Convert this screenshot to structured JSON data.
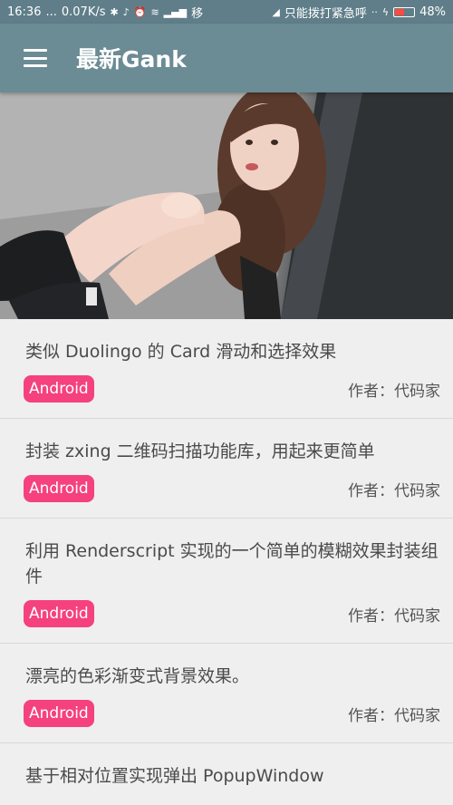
{
  "status_bar": {
    "time": "16:36",
    "dots": "...",
    "speed": "0.07K/s",
    "carrier": "移",
    "notification": "只能拨打紧急呼",
    "battery_percent": "48%",
    "battery_level": 0.48
  },
  "app_bar": {
    "title": "最新Gank"
  },
  "articles": [
    {
      "title": "类似 Duolingo 的 Card 滑动和选择效果",
      "tag": "Android",
      "author": "作者：代码家"
    },
    {
      "title": "封装 zxing 二维码扫描功能库，用起来更简单",
      "tag": "Android",
      "author": "作者：代码家"
    },
    {
      "title": "利用 Renderscript 实现的一个简单的模糊效果封装组件",
      "tag": "Android",
      "author": "作者：代码家"
    },
    {
      "title": "漂亮的色彩渐变式背景效果。",
      "tag": "Android",
      "author": "作者：代码家"
    },
    {
      "title": "基于相对位置实现弹出 PopupWindow",
      "tag": "",
      "author": ""
    }
  ],
  "colors": {
    "status_bar": "#5f7e89",
    "app_bar": "#6b8b95",
    "tag": "#f5417e",
    "background": "#efefef"
  }
}
